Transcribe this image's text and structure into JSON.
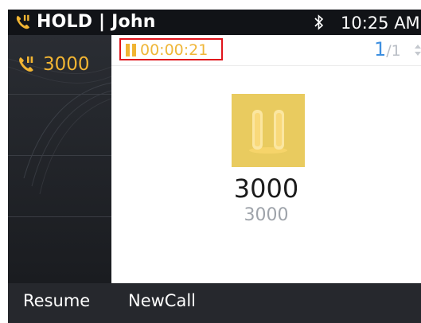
{
  "status_bar": {
    "title": "HOLD | John",
    "time": "10:25 AM",
    "icons": [
      "phone-hold-icon",
      "bluetooth-icon"
    ]
  },
  "sidebar": {
    "lines": [
      {
        "label": "3000",
        "icon": "phone-hold-icon",
        "active": true
      }
    ]
  },
  "call": {
    "timer": "00:00:21",
    "page_current": "1",
    "page_total": "/1",
    "name": "3000",
    "number": "3000",
    "status_icon": "pause-icon"
  },
  "softkeys": {
    "resume": "Resume",
    "newcall": "NewCall"
  },
  "colors": {
    "accent": "#f2b533",
    "hold_avatar": "#e9cb5f",
    "highlight_box": "#e0141b",
    "page_indicator": "#3d8fe0"
  }
}
